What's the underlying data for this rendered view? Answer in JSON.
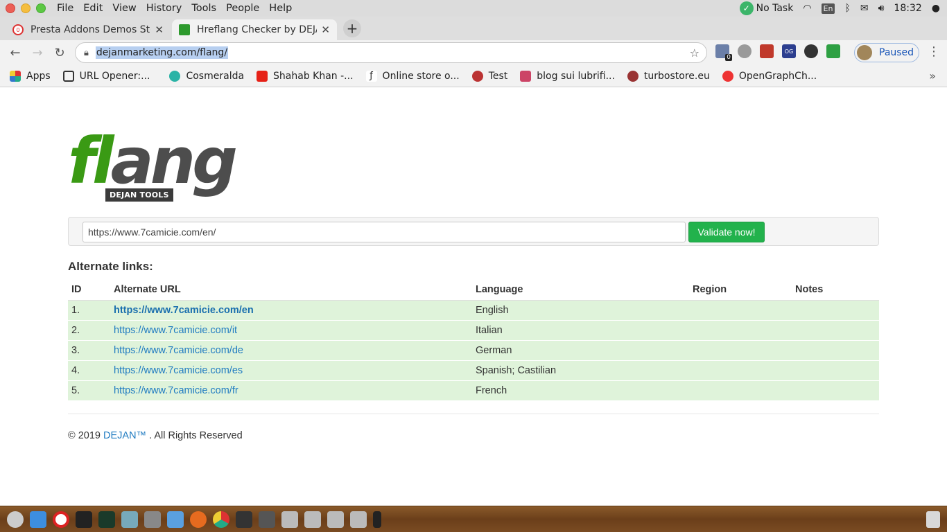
{
  "os": {
    "menu": [
      "File",
      "Edit",
      "View",
      "History",
      "Tools",
      "People",
      "Help"
    ],
    "status_task": "No Task",
    "keyboard": "En",
    "clock": "18:32"
  },
  "tabs": [
    {
      "title": "Presta Addons Demos Sto",
      "active": false
    },
    {
      "title": "Hreflang Checker by DEJA",
      "active": true
    }
  ],
  "omnibox": {
    "url": "dejanmarketing.com/flang/"
  },
  "profile": {
    "label": "Paused"
  },
  "extension_badge": "0",
  "bookmarks": [
    "Apps",
    "URL Opener:...",
    "Cosmeralda",
    "Shahab Khan -...",
    "Online store o...",
    "Test",
    "blog sui lubrifi...",
    "turbostore.eu",
    "OpenGraphCh..."
  ],
  "logo": {
    "word_green": "fl",
    "word_gray": "ang",
    "badge": "DEJAN TOOLS"
  },
  "form": {
    "url_value": "https://www.7camicie.com/en/",
    "button": "Validate now!"
  },
  "results": {
    "title": "Alternate links:",
    "headers": [
      "ID",
      "Alternate URL",
      "Language",
      "Region",
      "Notes"
    ],
    "rows": [
      {
        "id": "1.",
        "url": "https://www.7camicie.com/en",
        "language": "English",
        "region": "",
        "notes": ""
      },
      {
        "id": "2.",
        "url": "https://www.7camicie.com/it",
        "language": "Italian",
        "region": "",
        "notes": ""
      },
      {
        "id": "3.",
        "url": "https://www.7camicie.com/de",
        "language": "German",
        "region": "",
        "notes": ""
      },
      {
        "id": "4.",
        "url": "https://www.7camicie.com/es",
        "language": "Spanish; Castilian",
        "region": "",
        "notes": ""
      },
      {
        "id": "5.",
        "url": "https://www.7camicie.com/fr",
        "language": "French",
        "region": "",
        "notes": ""
      }
    ]
  },
  "footer": {
    "prefix": "© 2019",
    "brand": "DEJAN™",
    "suffix": ". All Rights Reserved"
  },
  "colors": {
    "accent_green": "#22b24c",
    "row_bg": "#dff3da",
    "link": "#1f7bc1",
    "logo_green": "#3a9a14"
  }
}
